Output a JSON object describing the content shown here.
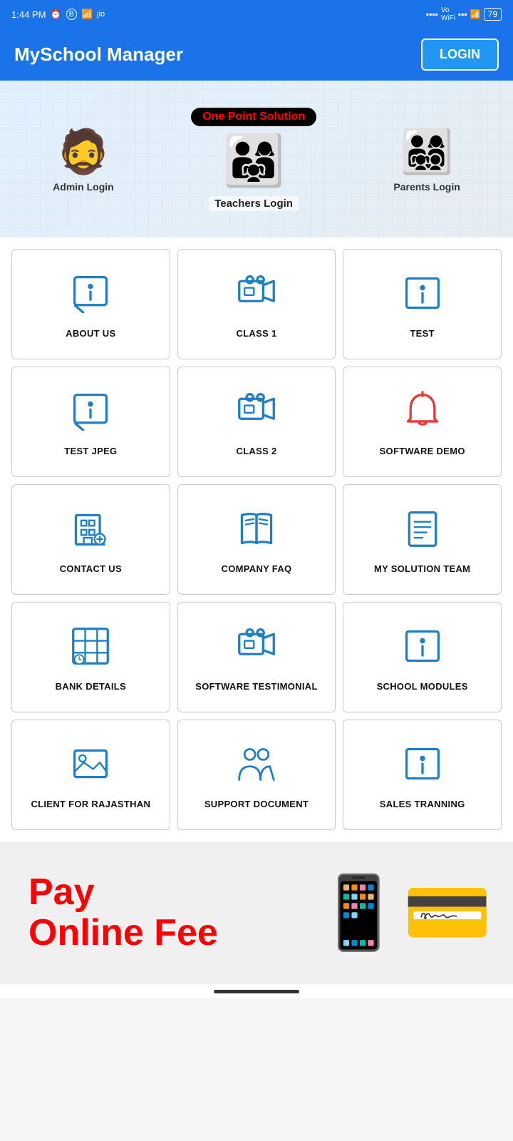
{
  "statusBar": {
    "time": "1:44 PM",
    "battery": "79"
  },
  "appBar": {
    "title": "MySchool Manager",
    "loginLabel": "LOGIN"
  },
  "banner": {
    "tagline": "One Point Solution",
    "adminLabel": "Admin Login",
    "teacherLabel": "Teachers Login",
    "parentsLabel": "Parents Login"
  },
  "grid": {
    "items": [
      {
        "id": "about-us",
        "label": "ABOUT US",
        "icon": "info"
      },
      {
        "id": "class-1",
        "label": "CLASS 1",
        "icon": "video"
      },
      {
        "id": "test",
        "label": "TEST",
        "icon": "info-box"
      },
      {
        "id": "test-jpeg",
        "label": "TEST JPEG",
        "icon": "info"
      },
      {
        "id": "class-2",
        "label": "CLASS 2",
        "icon": "video"
      },
      {
        "id": "software-demo",
        "label": "SOFTWARE DEMO",
        "icon": "bell"
      },
      {
        "id": "contact-us",
        "label": "CONTACT US",
        "icon": "building"
      },
      {
        "id": "company-faq",
        "label": "COMPANY FAQ",
        "icon": "book"
      },
      {
        "id": "my-solution-team",
        "label": "MY SOLUTION TEAM",
        "icon": "document"
      },
      {
        "id": "bank-details",
        "label": "BANK DETAILS",
        "icon": "grid-clock"
      },
      {
        "id": "software-testimonial",
        "label": "SOFTWARE TESTIMONIAL",
        "icon": "video"
      },
      {
        "id": "school-modules",
        "label": "SCHOOL MODULES",
        "icon": "info-box"
      },
      {
        "id": "client-rajasthan",
        "label": "CLIENT FOR RAJASTHAN",
        "icon": "image"
      },
      {
        "id": "support-document",
        "label": "SUPPORT DOCUMENT",
        "icon": "people"
      },
      {
        "id": "sales-tranning",
        "label": "SALES TRANNING",
        "icon": "info-box"
      }
    ]
  },
  "bottomBanner": {
    "line1": "Pay",
    "line2": "Online Fee"
  }
}
